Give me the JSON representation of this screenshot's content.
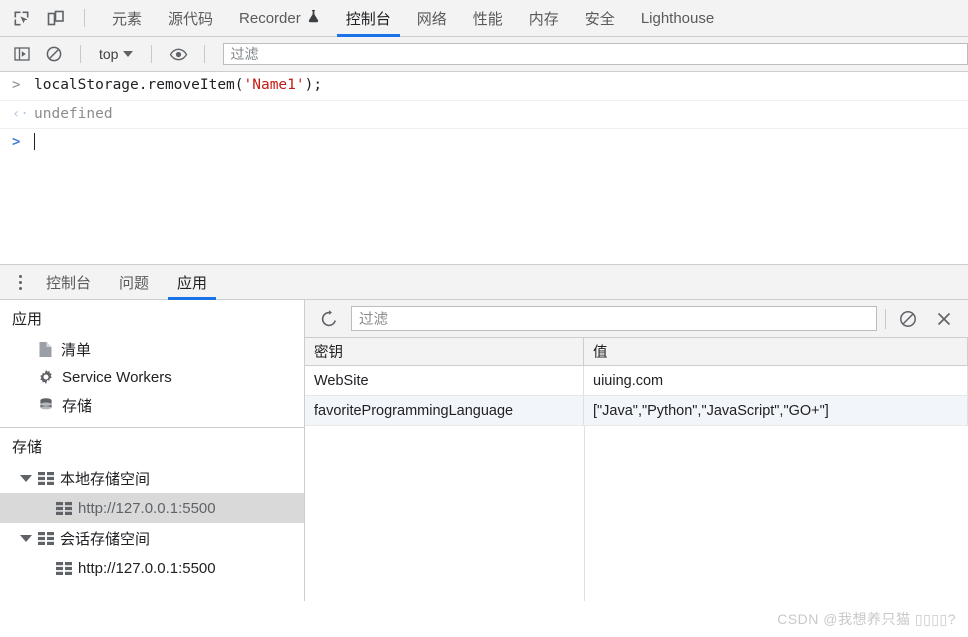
{
  "devtools": {
    "inspect_icon": "inspect-element-icon",
    "device_icon": "device-toolbar-icon",
    "tabs": [
      {
        "label": "元素",
        "active": false,
        "icon": null
      },
      {
        "label": "源代码",
        "active": false,
        "icon": null
      },
      {
        "label": "Recorder",
        "active": false,
        "icon": "flask-icon"
      },
      {
        "label": "控制台",
        "active": true,
        "icon": null
      },
      {
        "label": "网络",
        "active": false,
        "icon": null
      },
      {
        "label": "性能",
        "active": false,
        "icon": null
      },
      {
        "label": "内存",
        "active": false,
        "icon": null
      },
      {
        "label": "安全",
        "active": false,
        "icon": null
      },
      {
        "label": "Lighthouse",
        "active": false,
        "icon": null
      }
    ]
  },
  "console_toolbar": {
    "sidebar_toggle_icon": "console-sidebar-icon",
    "clear_icon": "clear-console-icon",
    "context_label": "top",
    "eye_icon": "live-expression-icon",
    "filter_placeholder": "过滤"
  },
  "console": {
    "entries": [
      {
        "type": "input",
        "marker": ">",
        "code_before": "localStorage.removeItem(",
        "code_string": "'Name1'",
        "code_after": ");"
      },
      {
        "type": "output",
        "marker": "‹·",
        "text": "undefined"
      },
      {
        "type": "prompt",
        "marker": ">",
        "text": ""
      }
    ]
  },
  "drawer": {
    "menu_icon": "more-options-icon",
    "tabs": [
      {
        "label": "控制台",
        "active": false
      },
      {
        "label": "问题",
        "active": false
      },
      {
        "label": "应用",
        "active": true
      }
    ]
  },
  "application": {
    "section_title": "应用",
    "items": [
      {
        "label": "清单",
        "icon": "manifest-document-icon"
      },
      {
        "label": "Service Workers",
        "icon": "gear-icon"
      },
      {
        "label": "存储",
        "icon": "database-icon"
      }
    ],
    "storage_title": "存储",
    "tree": [
      {
        "label": "本地存储空间",
        "level": 1,
        "expanded": true,
        "selected": false,
        "icon": "table-grid-icon"
      },
      {
        "label": "http://127.0.0.1:5500",
        "level": 2,
        "expanded": false,
        "selected": true,
        "icon": "table-grid-icon"
      },
      {
        "label": "会话存储空间",
        "level": 1,
        "expanded": true,
        "selected": false,
        "icon": "table-grid-icon"
      },
      {
        "label": "http://127.0.0.1:5500",
        "level": 2,
        "expanded": false,
        "selected": false,
        "icon": "table-grid-icon"
      }
    ]
  },
  "storage_view": {
    "refresh_icon": "refresh-icon",
    "filter_placeholder": "过滤",
    "clear_icon": "clear-all-icon",
    "delete_icon": "delete-selected-icon",
    "columns": [
      "密钥",
      "值"
    ],
    "rows": [
      {
        "key": "WebSite",
        "value": "uiuing.com"
      },
      {
        "key": "favoriteProgrammingLanguage",
        "value": "[\"Java\",\"Python\",\"JavaScript\",\"GO+\"]"
      }
    ]
  },
  "watermark": {
    "text": "CSDN @我想养只猫 ▯▯▯▯?"
  },
  "colors": {
    "accent": "#1a73e8",
    "toolbar_bg": "#f3f3f3",
    "selected_row": "#d9d9d9",
    "string_token": "#c41a16"
  }
}
